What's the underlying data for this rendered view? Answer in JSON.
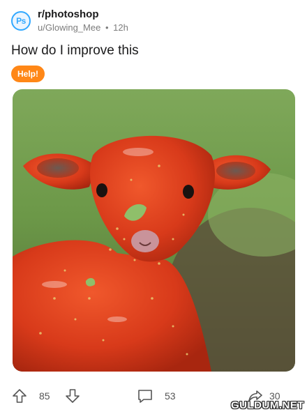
{
  "post": {
    "subreddit": "r/photoshop",
    "subreddit_icon_text": "Ps",
    "author": "u/Glowing_Mee",
    "separator": "•",
    "time_ago": "12h",
    "title": "How do I improve this",
    "flair": "Help!",
    "image_icon": "red-sauce-lamb-image"
  },
  "actions": {
    "upvote_icon": "arrow-up-icon",
    "score": "85",
    "downvote_icon": "arrow-down-icon",
    "comment_icon": "comment-bubble-icon",
    "comments": "53",
    "share_icon": "share-arrow-icon",
    "shares": "30"
  },
  "watermark": "GULDUM.NET",
  "colors": {
    "photoshop_blue": "#31a8ff",
    "flair_orange": "#ff8717",
    "sauce_red": "#d83a1a"
  }
}
